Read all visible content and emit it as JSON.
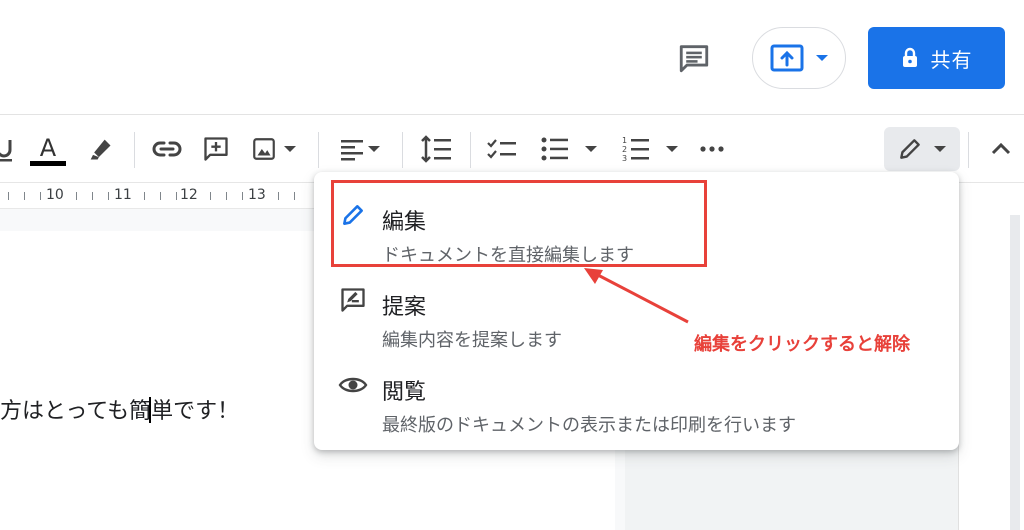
{
  "header": {
    "share_label": "共有",
    "comment_icon": "comment-icon",
    "present_icon": "present-upload-icon",
    "lock_icon": "lock-icon"
  },
  "toolbar": {
    "icons": [
      "underline-icon",
      "text-color-icon",
      "highlight-icon",
      "link-icon",
      "add-comment-icon",
      "insert-image-icon",
      "align-icon",
      "line-spacing-icon",
      "checklist-icon",
      "bulleted-list-icon",
      "numbered-list-icon",
      "more-icon",
      "editing-mode-pencil-icon",
      "collapse-icon"
    ],
    "text_color_bar": "#000000"
  },
  "ruler": {
    "numbers": [
      "10",
      "11",
      "12",
      "13"
    ]
  },
  "document": {
    "text_before_caret": "方はとっても簡",
    "text_after_caret": "単です！"
  },
  "mode_menu": {
    "items": [
      {
        "title": "編集",
        "subtitle": "ドキュメントを直接編集します",
        "icon": "pencil-icon"
      },
      {
        "title": "提案",
        "subtitle": "編集内容を提案します",
        "icon": "suggest-edit-icon"
      },
      {
        "title": "閲覧",
        "subtitle": "最終版のドキュメントの表示または印刷を行います",
        "icon": "eye-icon"
      }
    ]
  },
  "annotation": {
    "text": "編集をクリックすると解除",
    "color": "#e8413a"
  },
  "colors": {
    "accent": "#1a73e8",
    "annotation_red": "#e8413a"
  }
}
